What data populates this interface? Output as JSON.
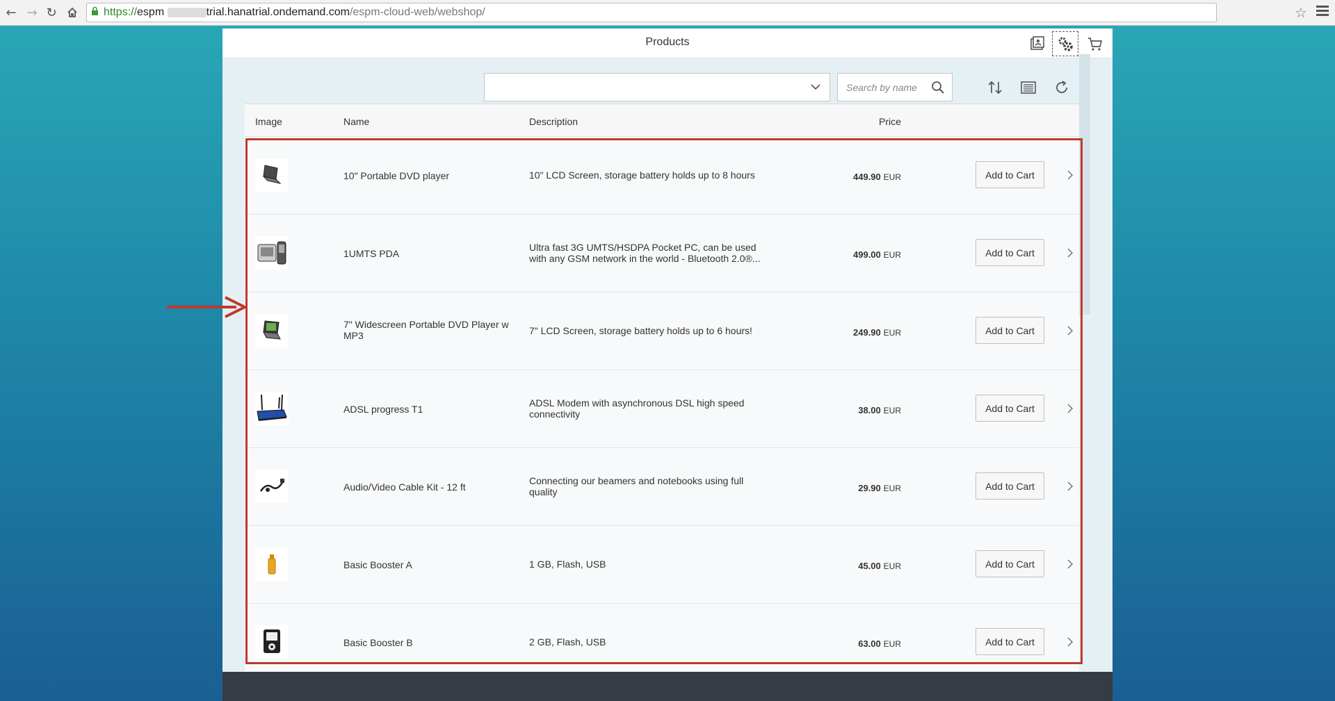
{
  "browser": {
    "url_scheme": "https://",
    "url_host_start": "espm",
    "url_host_end": "trial.hanatrial.ondemand.com",
    "url_path": "/espm-cloud-web/webshop/"
  },
  "header": {
    "title": "Products"
  },
  "toolbar": {
    "category_value": "",
    "search_placeholder": "Search by name"
  },
  "table": {
    "columns": {
      "image": "Image",
      "name": "Name",
      "description": "Description",
      "price": "Price"
    },
    "add_to_cart_label": "Add to Cart",
    "rows": [
      {
        "name": "10\" Portable DVD player",
        "desc": "10\" LCD Screen, storage battery holds up to 8 hours",
        "price": "449.90",
        "currency": "EUR",
        "image_icon": "laptop-dvd-icon"
      },
      {
        "name": "1UMTS PDA",
        "desc": "Ultra fast 3G UMTS/HSDPA Pocket PC, can be used with any GSM network in the world - Bluetooth 2.0®...",
        "price": "499.00",
        "currency": "EUR",
        "image_icon": "pda-phone-icon"
      },
      {
        "name": "7\" Widescreen Portable DVD Player w MP3",
        "desc": "7\" LCD Screen, storage battery holds up to 6 hours!",
        "price": "249.90",
        "currency": "EUR",
        "image_icon": "laptop-dvd-icon"
      },
      {
        "name": "ADSL progress T1",
        "desc": "ADSL Modem with asynchronous DSL high speed connectivity",
        "price": "38.00",
        "currency": "EUR",
        "image_icon": "router-icon"
      },
      {
        "name": "Audio/Video Cable Kit - 12 ft",
        "desc": "Connecting our beamers and notebooks using full quality",
        "price": "29.90",
        "currency": "EUR",
        "image_icon": "cable-icon"
      },
      {
        "name": "Basic Booster A",
        "desc": "1 GB, Flash, USB",
        "price": "45.00",
        "currency": "EUR",
        "image_icon": "usb-stick-icon"
      },
      {
        "name": "Basic Booster B",
        "desc": "2 GB, Flash, USB",
        "price": "63.00",
        "currency": "EUR",
        "image_icon": "mp3-player-icon"
      }
    ]
  },
  "colors": {
    "annotation_red": "#c0392b",
    "footer": "#353c43",
    "content_bg": "#e4f0f4"
  }
}
